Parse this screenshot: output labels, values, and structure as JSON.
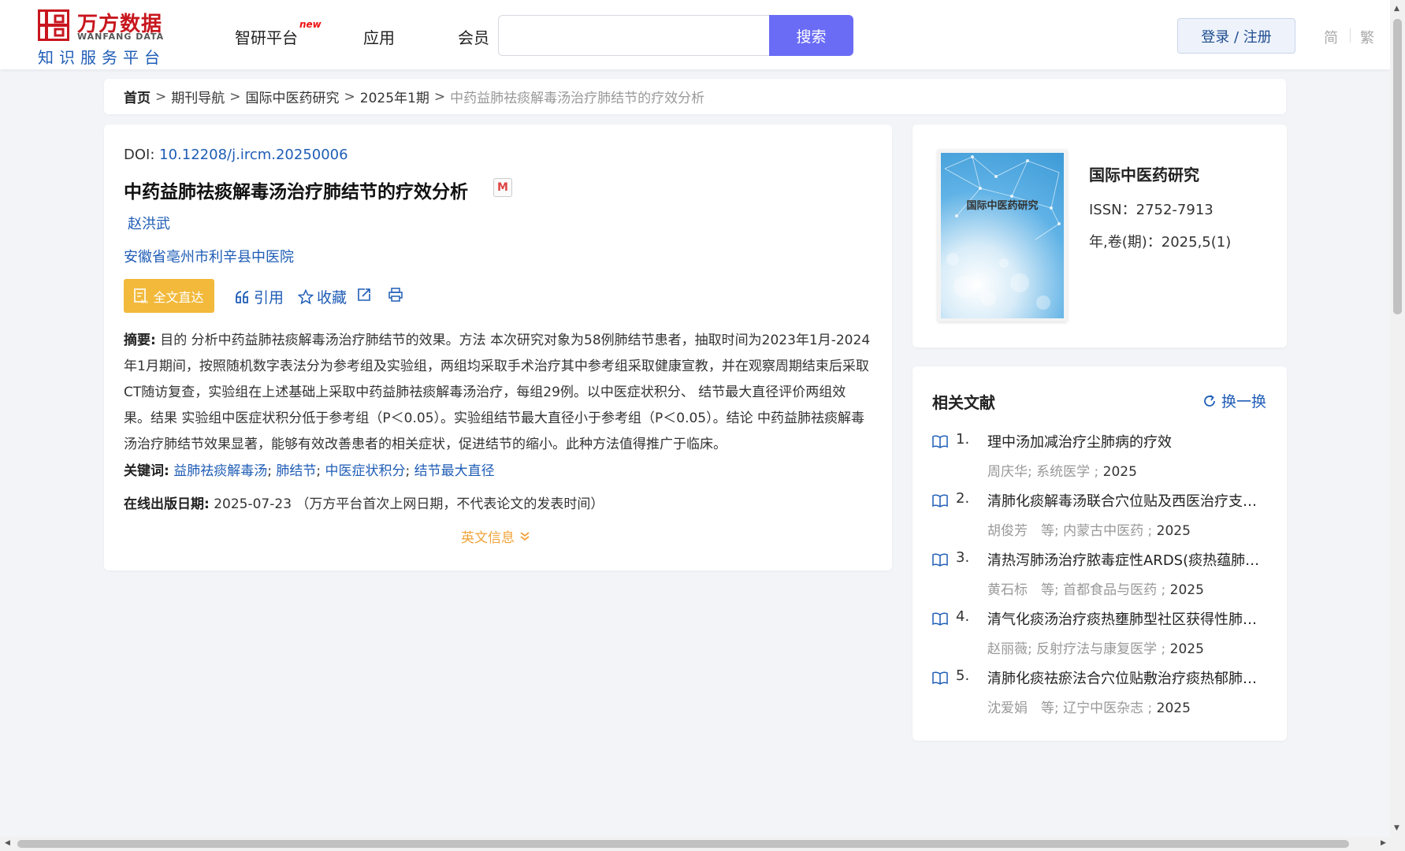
{
  "header": {
    "logo_cn": "万方数据",
    "logo_en": "WANFANG DATA",
    "logo_sub": "知识服务平台",
    "nav": [
      {
        "label": "智研平台",
        "badge": "new"
      },
      {
        "label": "应用"
      },
      {
        "label": "会员"
      }
    ],
    "search": {
      "placeholder": "",
      "value": "",
      "button_label": "搜索"
    },
    "login_label": "登录 / 注册",
    "lang_simplified": "简",
    "lang_traditional": "繁",
    "accent_color": "#6a6cf6"
  },
  "breadcrumb": {
    "items": [
      "首页",
      "期刊导航",
      "国际中医药研究",
      "2025年1期"
    ],
    "separator": ">",
    "current": "中药益肺祛痰解毒汤治疗肺结节的疗效分析"
  },
  "article": {
    "doi_label": "DOI:",
    "doi": "10.12208/j.ircm.20250006",
    "title": "中药益肺祛痰解毒汤治疗肺结节的疗效分析",
    "badge": "M",
    "author": "赵洪武",
    "affiliation": "安徽省亳州市利辛县中医院",
    "actions": {
      "fulltext": "全文直达",
      "cite": "引用",
      "favorite": "收藏"
    },
    "abstract_label": "摘要:",
    "abstract": "目的 分析中药益肺祛痰解毒汤治疗肺结节的效果。方法 本次研究对象为58例肺结节患者，抽取时间为2023年1月-2024年1月期间，按照随机数字表法分为参考组及实验组，两组均采取手术治疗其中参考组采取健康宣教，并在观察周期结束后采取CT随访复查，实验组在上述基础上采取中药益肺祛痰解毒汤治疗，每组29例。以中医症状积分、 结节最大直径评价两组效果。结果 实验组中医症状积分低于参考组（P＜0.05）。实验组结节最大直径小于参考组（P＜0.05）。结论 中药益肺祛痰解毒汤治疗肺结节效果显著，能够有效改善患者的相关症状，促进结节的缩小。此种方法值得推广于临床。",
    "keywords_label": "关键词:",
    "keywords": [
      "益肺祛痰解毒汤",
      "肺结节",
      "中医症状积分",
      "结节最大直径"
    ],
    "pubdate_label": "在线出版日期:",
    "pubdate": "2025-07-23",
    "pubdate_note": "（万方平台首次上网日期，不代表论文的发表时间）",
    "english_info": "英文信息"
  },
  "journal": {
    "cover_title": "国际中医药研究",
    "name": "国际中医药研究",
    "issn": "ISSN：2752-7913",
    "issue": "年,卷(期)：2025,5(1)"
  },
  "related": {
    "title": "相关文献",
    "refresh": "换一换",
    "items": [
      {
        "num": "1.",
        "title": "理中汤加减治疗尘肺病的疗效",
        "meta": "周庆华; 系统医学 ;",
        "year": "2025"
      },
      {
        "num": "2.",
        "title": "清肺化痰解毒汤联合穴位贴及西医治疗支气管扩张症急性加重期的疗效",
        "meta": "胡俊芳　等;  内蒙古中医药 ;",
        "year": "2025"
      },
      {
        "num": "3.",
        "title": "清热泻肺汤治疗脓毒症性ARDS(痰热蕴肺型)的临床疗效",
        "meta": "黄石标　等;  首都食品与医药 ;",
        "year": "2025"
      },
      {
        "num": "4.",
        "title": "清气化痰汤治疗痰热壅肺型社区获得性肺炎的临床效果",
        "meta": "赵丽薇; 反射疗法与康复医学 ;",
        "year": "2025"
      },
      {
        "num": "5.",
        "title": "清肺化痰祛瘀法合穴位贴敷治疗痰热郁肺证慢性阻塞性肺疾病",
        "meta": "沈爱娟　等;  辽宁中医杂志 ;",
        "year": "2025"
      }
    ]
  }
}
